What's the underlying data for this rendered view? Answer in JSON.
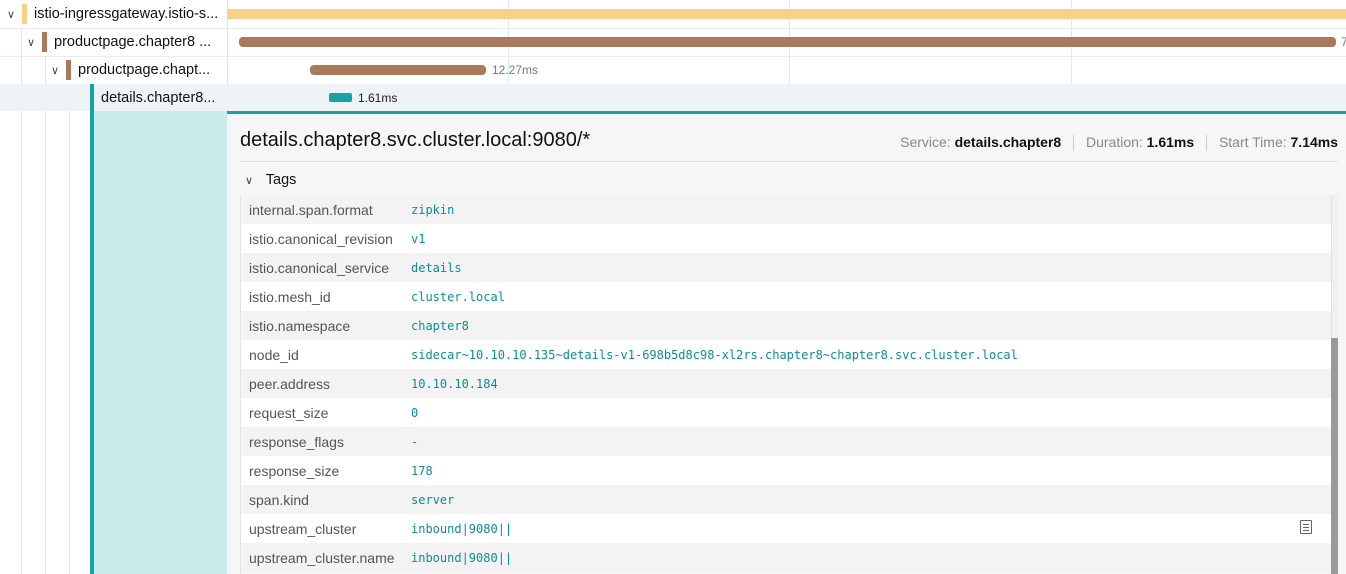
{
  "tree": [
    {
      "label": "istio-ingressgateway.istio-s...",
      "color": "#f7d08a",
      "expanded": true
    },
    {
      "label": "productpage.chapter8 ...",
      "color": "#a8795a",
      "expanded": true
    },
    {
      "label": "productpage.chapt...",
      "color": "#a8795a",
      "expanded": true
    },
    {
      "label": "details.chapter8...",
      "color": "#17a2a8",
      "expanded": false
    }
  ],
  "timeline": {
    "row1_tail": "7",
    "row2_duration": "12.27ms",
    "row3_duration": "1.61ms"
  },
  "span_detail": {
    "title": "details.chapter8.svc.cluster.local:9080/*",
    "service_label": "Service:",
    "service_value": "details.chapter8",
    "duration_label": "Duration:",
    "duration_value": "1.61ms",
    "start_label": "Start Time:",
    "start_value": "7.14ms",
    "tags_label": "Tags"
  },
  "tags": [
    {
      "key": "internal.span.format",
      "value": "zipkin"
    },
    {
      "key": "istio.canonical_revision",
      "value": "v1"
    },
    {
      "key": "istio.canonical_service",
      "value": "details"
    },
    {
      "key": "istio.mesh_id",
      "value": "cluster.local"
    },
    {
      "key": "istio.namespace",
      "value": "chapter8"
    },
    {
      "key": "node_id",
      "value": "sidecar~10.10.10.135~details-v1-698b5d8c98-xl2rs.chapter8~chapter8.svc.cluster.local"
    },
    {
      "key": "peer.address",
      "value": "10.10.10.184"
    },
    {
      "key": "request_size",
      "value": "0"
    },
    {
      "key": "response_flags",
      "value": "-"
    },
    {
      "key": "response_size",
      "value": "178"
    },
    {
      "key": "span.kind",
      "value": "server"
    },
    {
      "key": "upstream_cluster",
      "value": "inbound|9080||"
    },
    {
      "key": "upstream_cluster.name",
      "value": "inbound|9080||"
    }
  ],
  "colors": {
    "accent": "#17a2a8",
    "ingress": "#f7d08a",
    "productpage": "#a8795a"
  }
}
